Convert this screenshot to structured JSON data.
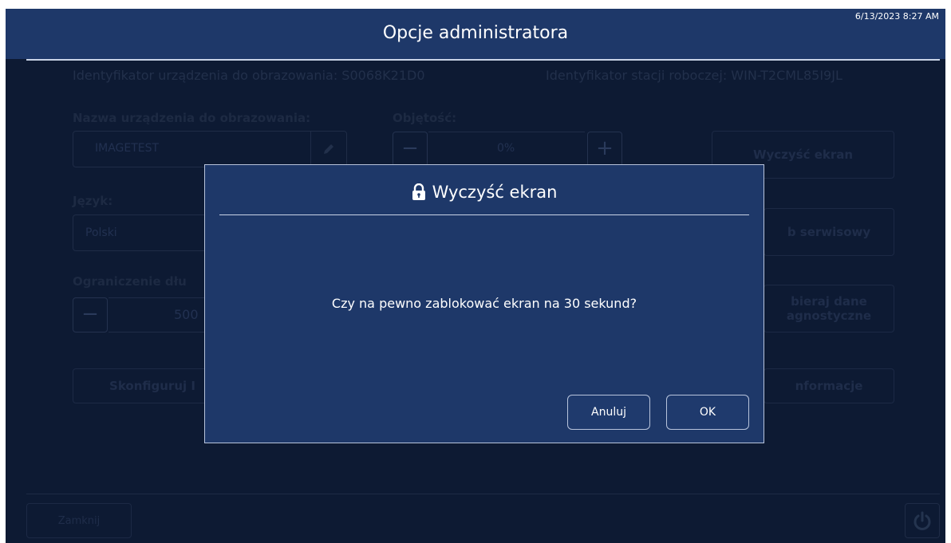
{
  "header": {
    "title": "Opcje administratora",
    "datetime": "6/13/2023 8:27 AM"
  },
  "background": {
    "device_id": "Identyfikator urządzenia do obrazowania: S0068K21D0",
    "workstation_id": "Identyfikator stacji roboczej: WIN-T2CML85I9JL",
    "device_name_label": "Nazwa urządzenia do obrazowania:",
    "device_name_value": "IMAGETEST",
    "volume_label": "Objętość:",
    "volume_value": "0%",
    "language_label": "Język:",
    "language_value": "Polski",
    "limit_label": "Ograniczenie dłu",
    "limit_value": "500",
    "configure_button": "Skonfiguruj I",
    "clear_screen_button": "Wyczyść ekran",
    "service_mode_button": "b serwisowy",
    "diagnostics_button_line1": "bieraj dane",
    "diagnostics_button_line2": "agnostyczne",
    "info_button": "nformacje",
    "close_button": "Zamknij"
  },
  "dialog": {
    "title": "Wyczyść ekran",
    "title_icon": "lock-icon",
    "message": "Czy na pewno zablokować ekran na 30 sekund?",
    "cancel_label": "Anuluj",
    "ok_label": "OK"
  },
  "icons": {
    "minus": "−",
    "plus": "+",
    "power": "power-icon",
    "edit": "pencil-icon"
  },
  "colors": {
    "header_bg": "#1e3869",
    "screen_bg": "#0d1a33",
    "dialog_bg": "#1e3869"
  }
}
